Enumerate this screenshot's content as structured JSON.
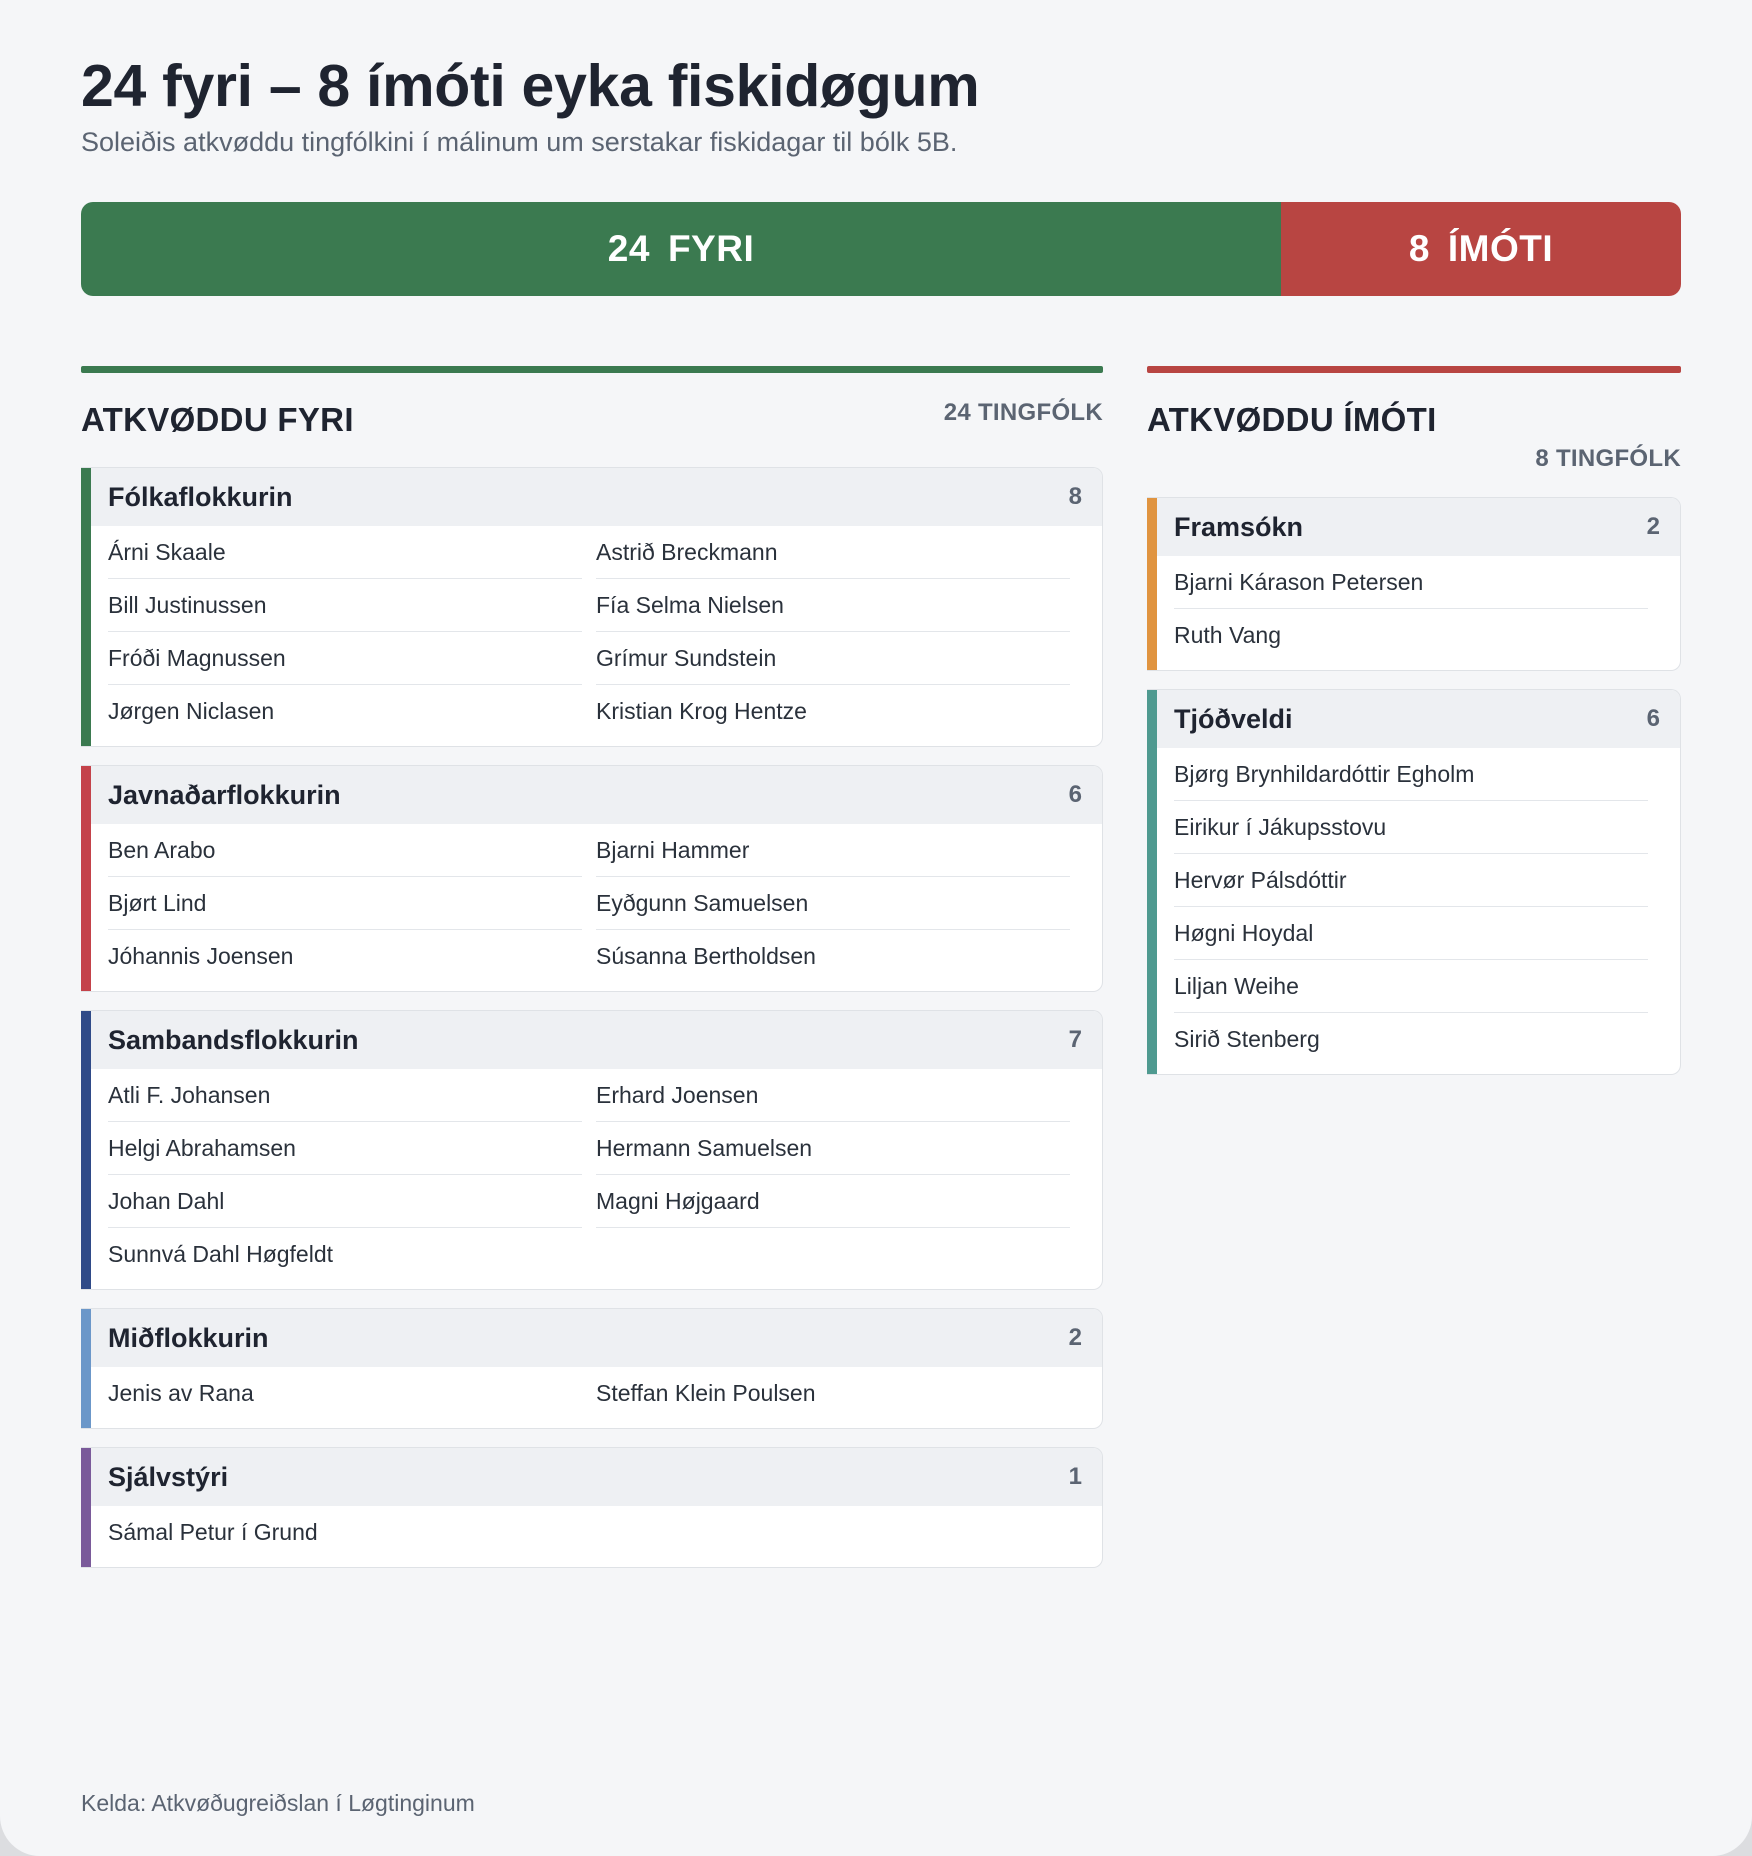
{
  "header": {
    "title": "24 fyri – 8 ímóti eyka fiskidøgum",
    "subtitle": "Soleiðis atkvøddu tingfólkini í málinum um serstakar fiskidagar til bólk 5B."
  },
  "votebar": {
    "yes_count": "24",
    "yes_label": "FYRI",
    "no_count": "8",
    "no_label": "ÍMÓTI",
    "yes_value": 24,
    "no_value": 8
  },
  "colors": {
    "yes": "#3b7a50",
    "no": "#b84542"
  },
  "for": {
    "title": "ATKVØDDU FYRI",
    "count": "24 TINGFÓLK",
    "parties": [
      {
        "name": "Fólkaflokkurin",
        "count": "8",
        "color": "#3b7a50",
        "members": [
          "Árni Skaale",
          "Astrið Breckmann",
          "Bill Justinussen",
          "Fía Selma Nielsen",
          "Fróði Magnussen",
          "Grímur Sundstein",
          "Jørgen Niclasen",
          "Kristian Krog Hentze"
        ]
      },
      {
        "name": "Javnaðarflokkurin",
        "count": "6",
        "color": "#c4424a",
        "members": [
          "Ben Arabo",
          "Bjarni Hammer",
          "Bjørt Lind",
          "Eyðgunn Samuelsen",
          "Jóhannis Joensen",
          "Súsanna Bertholdsen"
        ]
      },
      {
        "name": "Sambandsflokkurin",
        "count": "7",
        "color": "#2f4a88",
        "members": [
          "Atli F. Johansen",
          "Erhard Joensen",
          "Helgi Abrahamsen",
          "Hermann Samuelsen",
          "Johan Dahl",
          "Magni Højgaard",
          "Sunnvá Dahl Høgfeldt"
        ]
      },
      {
        "name": "Miðflokkurin",
        "count": "2",
        "color": "#6b97c9",
        "members": [
          "Jenis av Rana",
          "Steffan Klein Poulsen"
        ]
      },
      {
        "name": "Sjálvstýri",
        "count": "1",
        "color": "#7a5a9a",
        "members": [
          "Sámal Petur í Grund"
        ]
      }
    ]
  },
  "against": {
    "title": "ATKVØDDU ÍMÓTI",
    "count": "8 TINGFÓLK",
    "parties": [
      {
        "name": "Framsókn",
        "count": "2",
        "color": "#e09440",
        "members": [
          "Bjarni Kárason Petersen",
          "Ruth Vang"
        ]
      },
      {
        "name": "Tjóðveldi",
        "count": "6",
        "color": "#4f9a90",
        "members": [
          "Bjørg Brynhildardóttir Egholm",
          "Eirikur í Jákupsstovu",
          "Hervør Pálsdóttir",
          "Høgni Hoydal",
          "Liljan Weihe",
          "Sirið Stenberg"
        ]
      }
    ]
  },
  "footer": {
    "source": "Kelda: Atkvøðugreiðslan í Løgtinginum"
  }
}
